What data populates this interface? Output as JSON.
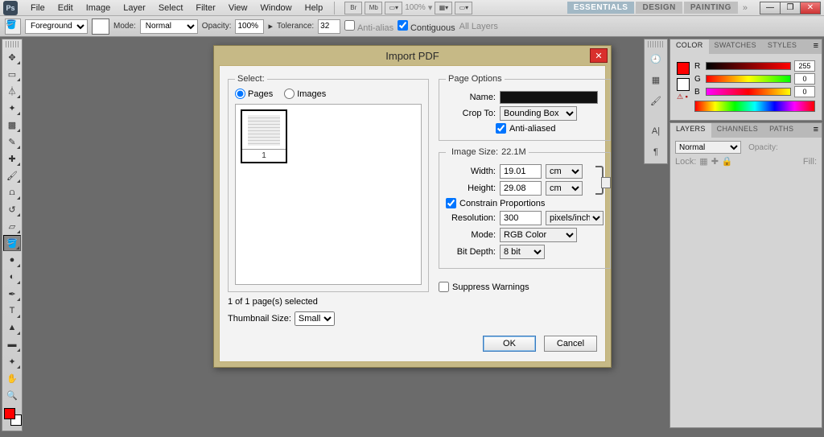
{
  "menubar": {
    "items": [
      "File",
      "Edit",
      "Image",
      "Layer",
      "Select",
      "Filter",
      "View",
      "Window",
      "Help"
    ],
    "zoom": "100%"
  },
  "workspace": {
    "buttons": [
      "ESSENTIALS",
      "DESIGN",
      "PAINTING"
    ],
    "active": 0
  },
  "optbar": {
    "fill_label": "Foreground",
    "mode_label": "Mode:",
    "mode_value": "Normal",
    "opacity_label": "Opacity:",
    "opacity_value": "100%",
    "tolerance_label": "Tolerance:",
    "tolerance_value": "32",
    "antialias": "Anti-alias",
    "contiguous": "Contiguous",
    "alllayers": "All Layers"
  },
  "panels": {
    "color": {
      "tabs": [
        "COLOR",
        "SWATCHES",
        "STYLES"
      ],
      "r": "255",
      "g": "0",
      "b": "0"
    },
    "layers": {
      "tabs": [
        "LAYERS",
        "CHANNELS",
        "PATHS"
      ],
      "blend": "Normal",
      "opacity_lbl": "Opacity:",
      "lock_lbl": "Lock:",
      "fill_lbl": "Fill:"
    }
  },
  "dialog": {
    "title": "Import PDF",
    "select_legend": "Select:",
    "radio_pages": "Pages",
    "radio_images": "Images",
    "thumb_page": "1",
    "paging": "1 of 1 page(s) selected",
    "thumb_size_label": "Thumbnail Size:",
    "thumb_size_value": "Small",
    "page_options_legend": "Page Options",
    "name_label": "Name:",
    "crop_label": "Crop To:",
    "crop_value": "Bounding Box",
    "antialiased": "Anti-aliased",
    "image_size_legend": "Image Size:",
    "image_size_value": "22.1M",
    "width_label": "Width:",
    "width_value": "19.01",
    "width_unit": "cm",
    "height_label": "Height:",
    "height_value": "29.08",
    "height_unit": "cm",
    "constrain": "Constrain Proportions",
    "resolution_label": "Resolution:",
    "resolution_value": "300",
    "resolution_unit": "pixels/inch",
    "mode_label": "Mode:",
    "mode_value": "RGB Color",
    "bitdepth_label": "Bit Depth:",
    "bitdepth_value": "8 bit",
    "suppress": "Suppress Warnings",
    "ok": "OK",
    "cancel": "Cancel"
  }
}
